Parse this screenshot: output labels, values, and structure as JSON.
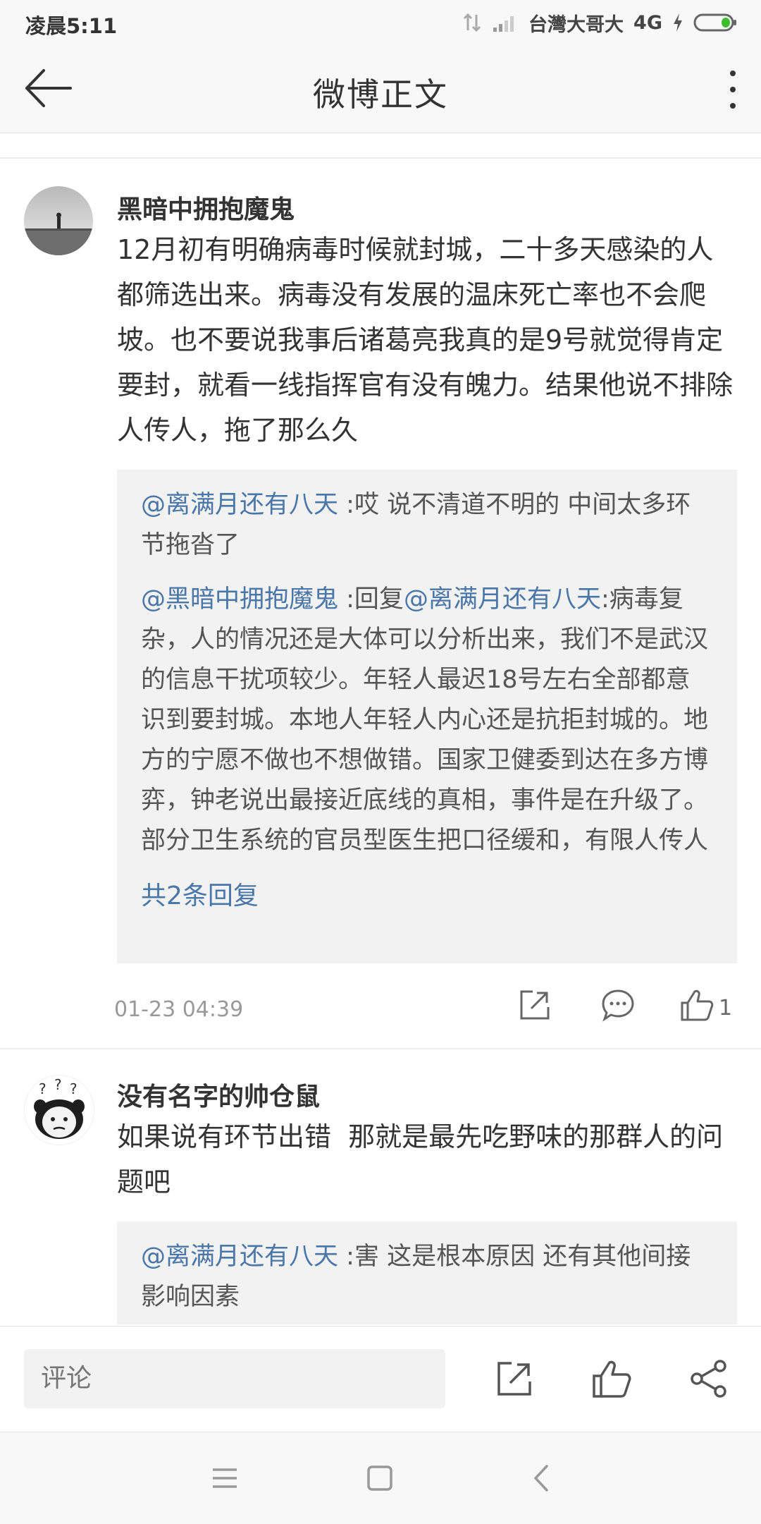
{
  "status_bar": {
    "time": "凌晨5:11",
    "carrier": "台灣大哥大",
    "network": "4G"
  },
  "header": {
    "title": "微博正文"
  },
  "comments": [
    {
      "username": "黑暗中拥抱魔鬼",
      "text": "12月初有明确病毒时候就封城，二十多天感染的人都筛选出来。病毒没有发展的温床死亡率也不会爬坡。也不要说我事后诸葛亮我真的是9号就觉得肯定要封，就看一线指挥官有没有魄力。结果他说不排除人传人，拖了那么久",
      "replies": [
        {
          "author": "@离满月还有八天",
          "sep": " :",
          "text": "哎 说不清道不明的 中间太多环节拖沓了"
        },
        {
          "author": "@黑暗中拥抱魔鬼",
          "sep": " :回复",
          "target": "@离满月还有八天",
          "sep2": ":",
          "text": "病毒复杂，人的情况还是大体可以分析出来，我们不是武汉的信息干扰项较少。年轻人最迟18号左右全部都意识到要封城。本地人年轻人内心还是抗拒封城的。地方的宁愿不做也不想做错。国家卫健委到达在多方博弈，钟老说出最接近底线的真相，事件是在升级了。部分卫生系统的官员型医生把口径缓和，有限人传人"
        }
      ],
      "reply_count": "共2条回复",
      "timestamp": "01-23 04:39",
      "likes": "1"
    },
    {
      "username": "没有名字的帅仓鼠",
      "text": "如果说有环节出错  那就是最先吃野味的那群人的问题吧",
      "replies": [
        {
          "author": "@离满月还有八天",
          "sep": " :",
          "text": "害 这是根本原因 还有其他间接影响因素"
        }
      ]
    }
  ],
  "bottom_bar": {
    "comment_placeholder": "评论"
  },
  "icons": {
    "back": "arrow-left-icon",
    "more": "more-vertical-icon",
    "share": "share-icon",
    "comment": "comment-icon",
    "like": "thumbs-up-icon",
    "forward": "share-nodes-icon"
  },
  "colors": {
    "link": "#4a76a8",
    "reply_bg": "#f2f2f2",
    "muted": "#999999"
  }
}
